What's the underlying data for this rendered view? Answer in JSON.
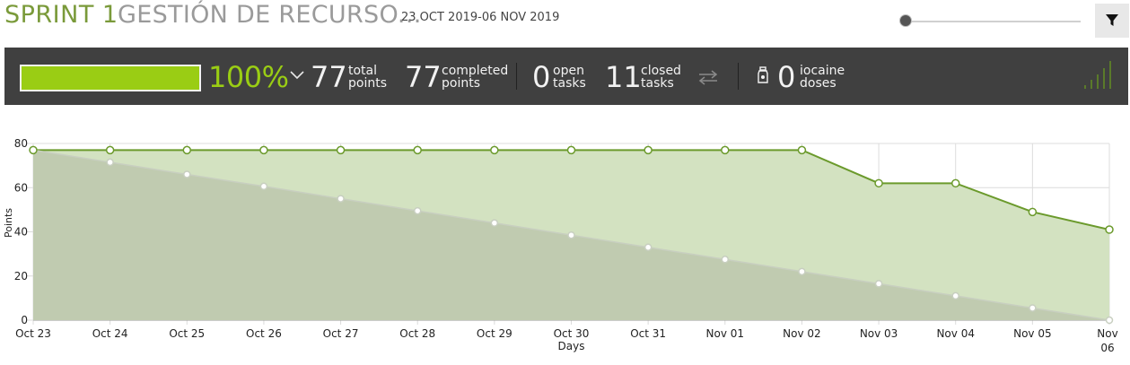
{
  "header": {
    "sprint_label": "SPRINT 1",
    "sprint_name": "GESTIÓN DE RECURSO...",
    "date_range": "23 OCT 2019-06 NOV 2019",
    "slider_level": 0,
    "filter_icon": "filter-icon"
  },
  "summary": {
    "progress_percent": 100,
    "progress_text": "100%",
    "total_points": "77",
    "total_points_label_1": "total",
    "total_points_label_2": "points",
    "completed_points": "77",
    "completed_points_label_1": "completed",
    "completed_points_label_2": "points",
    "open_tasks": "0",
    "open_tasks_label_1": "open",
    "open_tasks_label_2": "tasks",
    "closed_tasks": "11",
    "closed_tasks_label_1": "closed",
    "closed_tasks_label_2": "tasks",
    "iocaine_doses": "0",
    "iocaine_label_1": "iocaine",
    "iocaine_label_2": "doses",
    "colors": {
      "accent": "#9acd14",
      "bar_background": "#404040",
      "text": "#f2f2f2"
    }
  },
  "chart_data": {
    "type": "area",
    "title": "",
    "xlabel": "Days",
    "ylabel": "Points",
    "ylim": [
      0,
      80
    ],
    "yticks": [
      "0",
      "20",
      "40",
      "60",
      "80"
    ],
    "categories": [
      "Oct 23",
      "Oct 24",
      "Oct 25",
      "Oct 26",
      "Oct 27",
      "Oct 28",
      "Oct 29",
      "Oct 30",
      "Oct 31",
      "Nov 01",
      "Nov 02",
      "Nov 03",
      "Nov 04",
      "Nov 05",
      "Nov 06"
    ],
    "series": [
      {
        "color": "#6b9a2c",
        "fill": "#d3e2c1",
        "values": [
          77,
          77,
          77,
          77,
          77,
          77,
          77,
          77,
          77,
          77,
          77,
          62,
          62,
          49,
          41
        ]
      },
      {
        "color": "#c8cfc0",
        "fill": "#bcc7ad",
        "values": [
          77,
          71.5,
          66,
          60.6,
          55,
          49.5,
          44,
          38.5,
          33,
          27.5,
          22,
          16.5,
          11,
          5.5,
          0
        ]
      }
    ],
    "grid": true,
    "legend": "none"
  }
}
